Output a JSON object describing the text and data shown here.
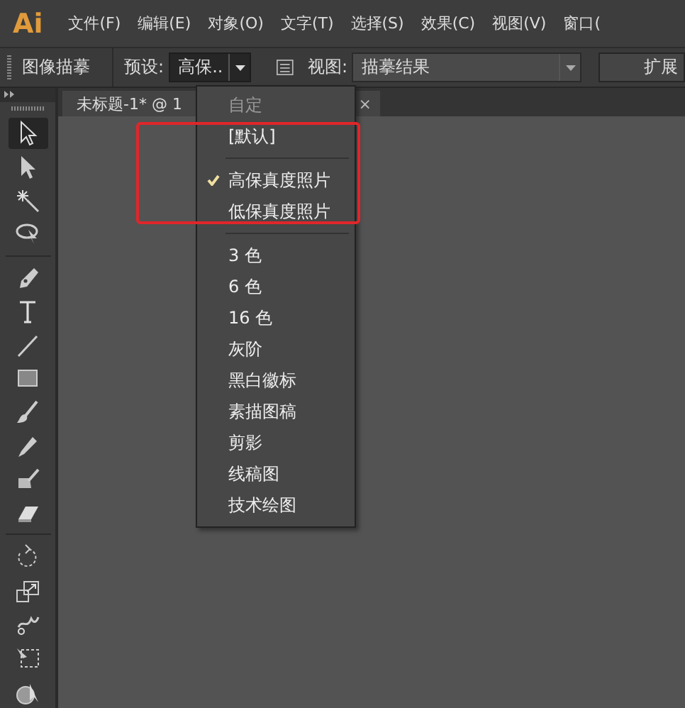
{
  "app": {
    "logo": "Ai"
  },
  "menu_bar": [
    {
      "label": "文件(F)"
    },
    {
      "label": "编辑(E)"
    },
    {
      "label": "对象(O)"
    },
    {
      "label": "文字(T)"
    },
    {
      "label": "选择(S)"
    },
    {
      "label": "效果(C)"
    },
    {
      "label": "视图(V)"
    },
    {
      "label": "窗口("
    }
  ],
  "control_bar": {
    "panel_title": "图像描摹",
    "preset_label": "预设:",
    "preset_value": "高保..",
    "view_label": "视图:",
    "view_value": "描摹结果",
    "expand_button": "扩展"
  },
  "document_tab": {
    "title": "未标题-1* @ 1",
    "close": "×"
  },
  "tools": [
    {
      "kind": "selection",
      "selected": true
    },
    {
      "kind": "direct-selection",
      "selected": false
    },
    {
      "kind": "magic-wand",
      "selected": false
    },
    {
      "kind": "lasso",
      "selected": false
    },
    {
      "kind": "separator"
    },
    {
      "kind": "pen",
      "selected": false
    },
    {
      "kind": "type",
      "selected": false
    },
    {
      "kind": "line",
      "selected": false
    },
    {
      "kind": "rectangle",
      "selected": false
    },
    {
      "kind": "paintbrush",
      "selected": false
    },
    {
      "kind": "pencil",
      "selected": false
    },
    {
      "kind": "blob-brush",
      "selected": false
    },
    {
      "kind": "eraser",
      "selected": false
    },
    {
      "kind": "separator"
    },
    {
      "kind": "rotate",
      "selected": false
    },
    {
      "kind": "scale",
      "selected": false
    },
    {
      "kind": "puppet-warp",
      "selected": false
    },
    {
      "kind": "free-transform",
      "selected": false
    },
    {
      "kind": "shape-builder",
      "selected": false
    }
  ],
  "preset_menu": {
    "items": [
      {
        "kind": "item",
        "label": "自定",
        "disabled": true,
        "checked": false
      },
      {
        "kind": "item",
        "label": "[默认]",
        "disabled": false,
        "checked": false
      },
      {
        "kind": "separator"
      },
      {
        "kind": "item",
        "label": "高保真度照片",
        "disabled": false,
        "checked": true
      },
      {
        "kind": "item",
        "label": "低保真度照片",
        "disabled": false,
        "checked": false
      },
      {
        "kind": "separator"
      },
      {
        "kind": "item",
        "label": "3 色",
        "disabled": false,
        "checked": false
      },
      {
        "kind": "item",
        "label": "6 色",
        "disabled": false,
        "checked": false
      },
      {
        "kind": "item",
        "label": "16 色",
        "disabled": false,
        "checked": false
      },
      {
        "kind": "item",
        "label": "灰阶",
        "disabled": false,
        "checked": false
      },
      {
        "kind": "item",
        "label": "黑白徽标",
        "disabled": false,
        "checked": false
      },
      {
        "kind": "item",
        "label": "素描图稿",
        "disabled": false,
        "checked": false
      },
      {
        "kind": "item",
        "label": "剪影",
        "disabled": false,
        "checked": false
      },
      {
        "kind": "item",
        "label": "线稿图",
        "disabled": false,
        "checked": false
      },
      {
        "kind": "item",
        "label": "技术绘图",
        "disabled": false,
        "checked": false
      }
    ]
  }
}
